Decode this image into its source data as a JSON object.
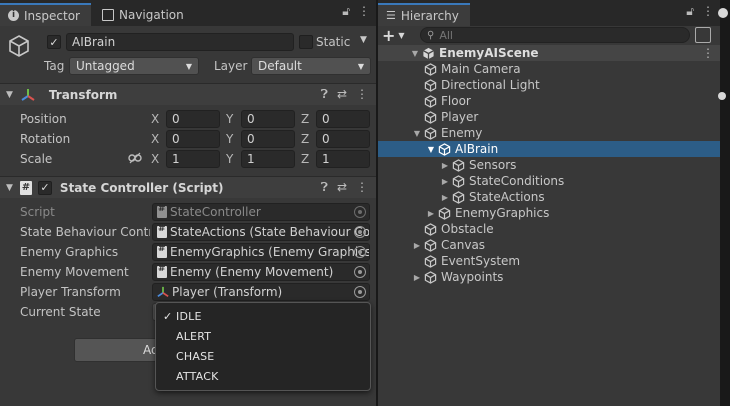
{
  "inspector": {
    "tabs": [
      {
        "label": "Inspector",
        "icon": "info-icon"
      },
      {
        "label": "Navigation",
        "icon": "navigation-icon"
      }
    ],
    "object": {
      "enabled": true,
      "name": "AIBrain",
      "static_label": "Static",
      "tag_label": "Tag",
      "tag_value": "Untagged",
      "layer_label": "Layer",
      "layer_value": "Default"
    },
    "transform": {
      "title": "Transform",
      "rows": [
        {
          "label": "Position",
          "x": "0",
          "y": "0",
          "z": "0"
        },
        {
          "label": "Rotation",
          "x": "0",
          "y": "0",
          "z": "0"
        },
        {
          "label": "Scale",
          "x": "1",
          "y": "1",
          "z": "1"
        }
      ],
      "axes": [
        "X",
        "Y",
        "Z"
      ]
    },
    "state_controller": {
      "title": "State Controller (Script)",
      "fields": [
        {
          "label": "Script",
          "value": "StateController",
          "icon": "script-icon",
          "disabled": true
        },
        {
          "label": "State Behaviour Contro",
          "value": "StateActions (State Behaviour Co",
          "icon": "script-icon"
        },
        {
          "label": "Enemy Graphics",
          "value": "EnemyGraphics (Enemy Graphics",
          "icon": "script-icon"
        },
        {
          "label": "Enemy Movement",
          "value": "Enemy (Enemy Movement)",
          "icon": "script-icon"
        },
        {
          "label": "Player Transform",
          "value": "Player (Transform)",
          "icon": "transform-icon"
        }
      ],
      "current_state_label": "Current State",
      "add_button_partial": "Ad"
    },
    "state_dropdown": {
      "options": [
        "IDLE",
        "ALERT",
        "CHASE",
        "ATTACK"
      ],
      "selected": "IDLE"
    }
  },
  "hierarchy": {
    "tab_label": "Hierarchy",
    "search_placeholder": "All",
    "add_label": "+",
    "scene": "EnemyAIScene",
    "items": [
      {
        "label": "Main Camera",
        "depth": 1,
        "arrow": ""
      },
      {
        "label": "Directional Light",
        "depth": 1,
        "arrow": ""
      },
      {
        "label": "Floor",
        "depth": 1,
        "arrow": ""
      },
      {
        "label": "Player",
        "depth": 1,
        "arrow": ""
      },
      {
        "label": "Enemy",
        "depth": 1,
        "arrow": "▼"
      },
      {
        "label": "AIBrain",
        "depth": 2,
        "arrow": "▼",
        "selected": true
      },
      {
        "label": "Sensors",
        "depth": 3,
        "arrow": "▶"
      },
      {
        "label": "StateConditions",
        "depth": 3,
        "arrow": "▶"
      },
      {
        "label": "StateActions",
        "depth": 3,
        "arrow": "▶"
      },
      {
        "label": "EnemyGraphics",
        "depth": 2,
        "arrow": "▶"
      },
      {
        "label": "Obstacle",
        "depth": 1,
        "arrow": ""
      },
      {
        "label": "Canvas",
        "depth": 1,
        "arrow": "▶"
      },
      {
        "label": "EventSystem",
        "depth": 1,
        "arrow": ""
      },
      {
        "label": "Waypoints",
        "depth": 1,
        "arrow": "▶"
      }
    ]
  },
  "colors": {
    "selection": "#2c5d87",
    "tab_accent": "#3a79bb",
    "panel_bg": "#383838"
  }
}
